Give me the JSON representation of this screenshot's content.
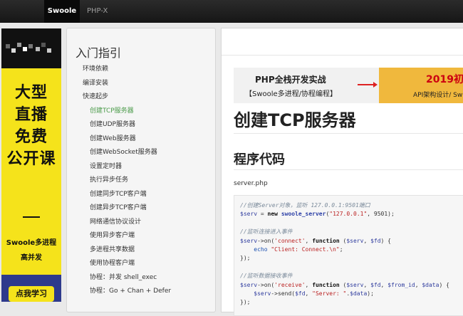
{
  "topnav": {
    "tabs": [
      "Swoole",
      "PHP-X"
    ],
    "active": "Swoole"
  },
  "ad": {
    "lines": [
      "大型",
      "直播",
      "免费",
      "公开课"
    ],
    "subtitle_1": "Swoole多进程",
    "subtitle_2": "高并发",
    "button": "点我学习"
  },
  "sidebar": {
    "title": "入门指引",
    "items": [
      {
        "label": "环境依赖",
        "level": 1
      },
      {
        "label": "编译安装",
        "level": 1
      },
      {
        "label": "快速起步",
        "level": 1
      },
      {
        "label": "创建TCP服务器",
        "level": 2,
        "active": true
      },
      {
        "label": "创建UDP服务器",
        "level": 2
      },
      {
        "label": "创建Web服务器",
        "level": 2
      },
      {
        "label": "创建WebSocket服务器",
        "level": 2
      },
      {
        "label": "设置定时器",
        "level": 2
      },
      {
        "label": "执行异步任务",
        "level": 2
      },
      {
        "label": "创建同步TCP客户端",
        "level": 2
      },
      {
        "label": "创建异步TCP客户端",
        "level": 2
      },
      {
        "label": "网络通信协议设计",
        "level": 2
      },
      {
        "label": "使用异步客户端",
        "level": 2
      },
      {
        "label": "多进程共享数据",
        "level": 2
      },
      {
        "label": "使用协程客户端",
        "level": 2
      },
      {
        "label": "协程：并发 shell_exec",
        "level": 2
      },
      {
        "label": "协程：Go + Chan + Defer",
        "level": 2
      }
    ]
  },
  "promo": {
    "title": "PHP全栈开发实战",
    "subtitle": "【Swoole多进程/协程编程】",
    "year": "2019初",
    "tagline": "API架构设计/ Sw"
  },
  "content": {
    "title": "创建TCP服务器",
    "section": "程序代码",
    "filename": "server.php"
  },
  "code": [
    [
      [
        "cm",
        "//创建Server对象，监听 127.0.0.1:9501端口"
      ]
    ],
    [
      [
        "var",
        "$serv"
      ],
      [
        "txt",
        " = "
      ],
      [
        "kw",
        "new"
      ],
      [
        "txt",
        " "
      ],
      [
        "fn",
        "swoole_server"
      ],
      [
        "txt",
        "("
      ],
      [
        "str",
        "\"127.0.0.1\""
      ],
      [
        "txt",
        ", 9501);"
      ]
    ],
    [],
    [
      [
        "cm",
        "//监听连接进入事件"
      ]
    ],
    [
      [
        "var",
        "$serv"
      ],
      [
        "txt",
        "->on("
      ],
      [
        "str",
        "'connect'"
      ],
      [
        "txt",
        ", "
      ],
      [
        "kw",
        "function"
      ],
      [
        "txt",
        " ("
      ],
      [
        "var",
        "$serv"
      ],
      [
        "txt",
        ", "
      ],
      [
        "var",
        "$fd"
      ],
      [
        "txt",
        ") {"
      ]
    ],
    [
      [
        "txt",
        "    "
      ],
      [
        "echo",
        "echo"
      ],
      [
        "txt",
        " "
      ],
      [
        "str",
        "\"Client: Connect.\\n\""
      ],
      [
        "txt",
        ";"
      ]
    ],
    [
      [
        "txt",
        "});"
      ]
    ],
    [],
    [
      [
        "cm",
        "//监听数据接收事件"
      ]
    ],
    [
      [
        "var",
        "$serv"
      ],
      [
        "txt",
        "->on("
      ],
      [
        "str",
        "'receive'"
      ],
      [
        "txt",
        ", "
      ],
      [
        "kw",
        "function"
      ],
      [
        "txt",
        " ("
      ],
      [
        "var",
        "$serv"
      ],
      [
        "txt",
        ", "
      ],
      [
        "var",
        "$fd"
      ],
      [
        "txt",
        ", "
      ],
      [
        "var",
        "$from_id"
      ],
      [
        "txt",
        ", "
      ],
      [
        "var",
        "$data"
      ],
      [
        "txt",
        ") {"
      ]
    ],
    [
      [
        "txt",
        "    "
      ],
      [
        "var",
        "$serv"
      ],
      [
        "txt",
        "->send("
      ],
      [
        "var",
        "$fd"
      ],
      [
        "txt",
        ", "
      ],
      [
        "str",
        "\"Server: \""
      ],
      [
        "txt",
        "."
      ],
      [
        "var",
        "$data"
      ],
      [
        "txt",
        ");"
      ]
    ],
    [
      [
        "txt",
        "});"
      ]
    ]
  ]
}
